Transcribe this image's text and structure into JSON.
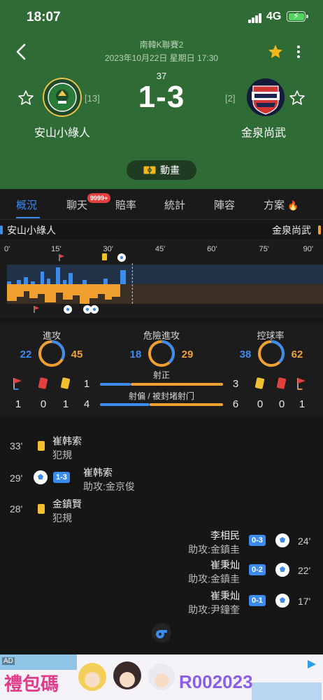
{
  "status_bar": {
    "time": "18:07",
    "network": "4G"
  },
  "header": {
    "league": "南韓K聯賽2",
    "datetime": "2023年10月22日 星期日 17:30",
    "minute": "37",
    "score": "1-3",
    "home": {
      "name": "安山小綠人",
      "rank": "[13]"
    },
    "away": {
      "name": "金泉尚武",
      "rank": "[2]"
    },
    "animation_label": "動畫",
    "accent_star": "#f4b81c"
  },
  "tabs": {
    "items": [
      "概況",
      "聊天",
      "賠率",
      "統計",
      "陣容",
      "方案"
    ],
    "active": "概況",
    "chat_badge": "9999+"
  },
  "timeline": {
    "home_name": "安山小綠人",
    "away_name": "金泉尚武",
    "ticks": [
      "0'",
      "15'",
      "30'",
      "45'",
      "60'",
      "75'",
      "90'"
    ],
    "current_minute": 37,
    "colors": {
      "home": "#3c8cf0",
      "away": "#f0a030"
    }
  },
  "stats": {
    "attack": {
      "label": "進攻",
      "home": "22",
      "away": "45"
    },
    "dangerous": {
      "label": "危險進攻",
      "home": "18",
      "away": "29"
    },
    "possession": {
      "label": "控球率",
      "home": "38",
      "away": "62"
    },
    "home_counts": {
      "corners": "1",
      "red": "0",
      "yellow": "1",
      "on_target": "1",
      "off_target": "4"
    },
    "away_counts": {
      "yellow": "0",
      "red": "0",
      "corners": "1",
      "on_target": "3",
      "off_target": "6"
    },
    "row1_label": "射正",
    "row2_label": "射偏 / 被封堵射门"
  },
  "events": [
    {
      "minute": "33'",
      "side": "home",
      "type": "yellow",
      "player": "崔韩索",
      "sub": "犯規"
    },
    {
      "minute": "29'",
      "side": "home",
      "type": "goal",
      "score": "1-3",
      "player": "崔韩索",
      "sub": "助攻:金京俊"
    },
    {
      "minute": "28'",
      "side": "home",
      "type": "yellow",
      "player": "金鎮賢",
      "sub": "犯規"
    },
    {
      "minute": "24'",
      "side": "away",
      "type": "goal",
      "score": "0-3",
      "player": "李相民",
      "sub": "助攻:金鎮圭"
    },
    {
      "minute": "22'",
      "side": "away",
      "type": "goal",
      "score": "0-2",
      "player": "崔秉灿",
      "sub": "助攻:金鎮圭"
    },
    {
      "minute": "17'",
      "side": "away",
      "type": "goal",
      "score": "0-1",
      "player": "崔秉灿",
      "sub": "助攻:尹鐘奎"
    }
  ],
  "ad": {
    "label": "AD",
    "title": "禮包碼",
    "code": "R002023"
  }
}
